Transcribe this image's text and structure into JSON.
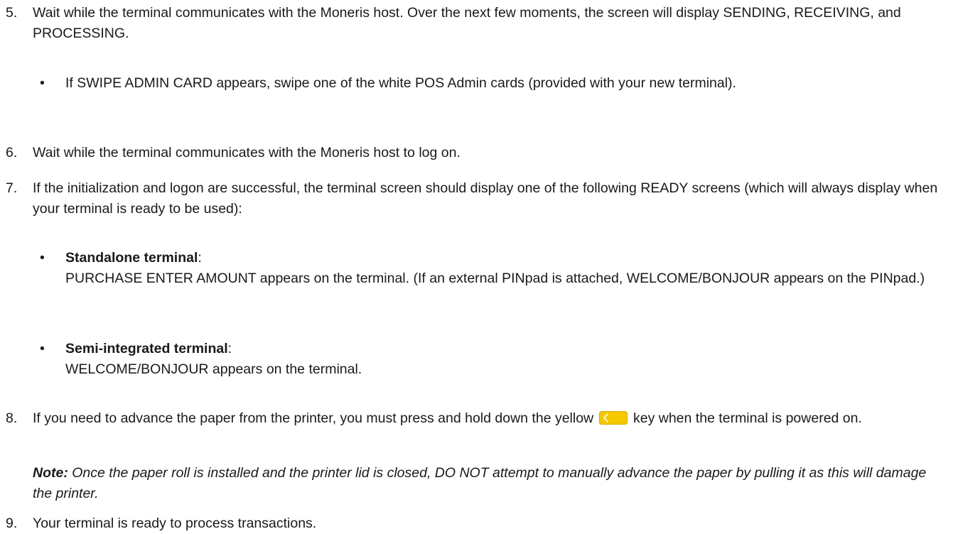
{
  "steps": {
    "step5": {
      "number": "5.",
      "text": "Wait while the terminal communicates with the Moneris host. Over the next few moments, the screen will display SENDING, RECEIVING, and PROCESSING.",
      "bullet_char": "•",
      "bullet_text": "If SWIPE ADMIN CARD appears, swipe one of the white POS Admin cards (provided with your new terminal)."
    },
    "step6": {
      "number": "6.",
      "text": "Wait while the terminal communicates with the Moneris host to log on."
    },
    "step7": {
      "number": "7.",
      "text": "If the initialization and logon are successful, the terminal screen should display one of the following READY screens (which will always display when your terminal is ready to be used):",
      "bullets": [
        {
          "char": "•",
          "title": "Standalone terminal",
          "colon": ":",
          "body": "PURCHASE ENTER AMOUNT appears on the terminal. (If an external PINpad is attached, WELCOME/BONJOUR appears on the PINpad.)"
        },
        {
          "char": "•",
          "title": "Semi-integrated terminal",
          "colon": ":",
          "body": "WELCOME/BONJOUR appears on the terminal."
        }
      ]
    },
    "step8": {
      "number": "8.",
      "text_before": "If you need to advance the paper from the printer, you must press and hold down the yellow",
      "key_icon": "yellow-back-key-icon",
      "key_color": "#f5c800",
      "text_after": "key when the terminal is powered on."
    },
    "note": {
      "label": "Note:",
      "text": "Once the paper roll is installed and the printer lid is closed, DO NOT attempt to manually advance the paper by pulling it as this will damage the printer."
    },
    "step9": {
      "number": "9.",
      "text": "Your terminal is ready to process transactions."
    }
  }
}
